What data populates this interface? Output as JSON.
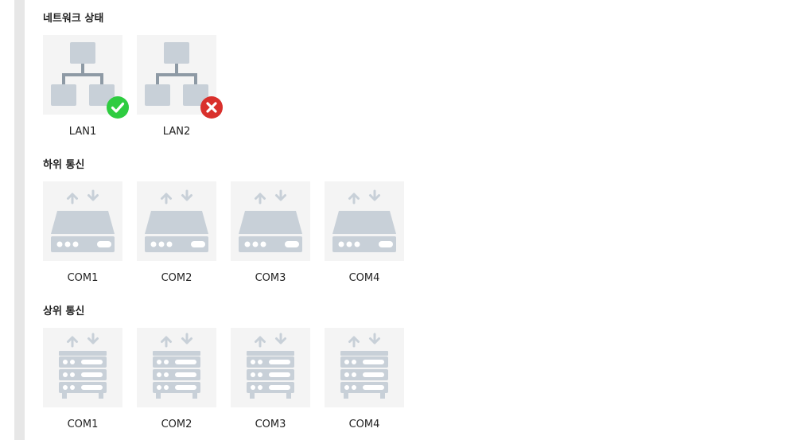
{
  "network_status": {
    "title": "네트워크 상태",
    "items": [
      {
        "label": "LAN1",
        "status": "connected",
        "icon": "network-topology-icon",
        "badge_icon": "check-icon",
        "badge_color": "#2ecc40"
      },
      {
        "label": "LAN2",
        "status": "disconnected",
        "icon": "network-topology-icon",
        "badge_icon": "close-icon",
        "badge_color": "#d9302c"
      }
    ]
  },
  "lower_comm": {
    "title": "하위 통신",
    "items": [
      {
        "label": "COM1",
        "icon": "serial-device-icon"
      },
      {
        "label": "COM2",
        "icon": "serial-device-icon"
      },
      {
        "label": "COM3",
        "icon": "serial-device-icon"
      },
      {
        "label": "COM4",
        "icon": "serial-device-icon"
      }
    ]
  },
  "upper_comm": {
    "title": "상위 통신",
    "items": [
      {
        "label": "COM1",
        "icon": "server-rack-icon"
      },
      {
        "label": "COM2",
        "icon": "server-rack-icon"
      },
      {
        "label": "COM3",
        "icon": "server-rack-icon"
      },
      {
        "label": "COM4",
        "icon": "server-rack-icon"
      }
    ]
  },
  "colors": {
    "icon_fill": "#c8d0d8",
    "tile_bg": "#f4f4f4"
  }
}
